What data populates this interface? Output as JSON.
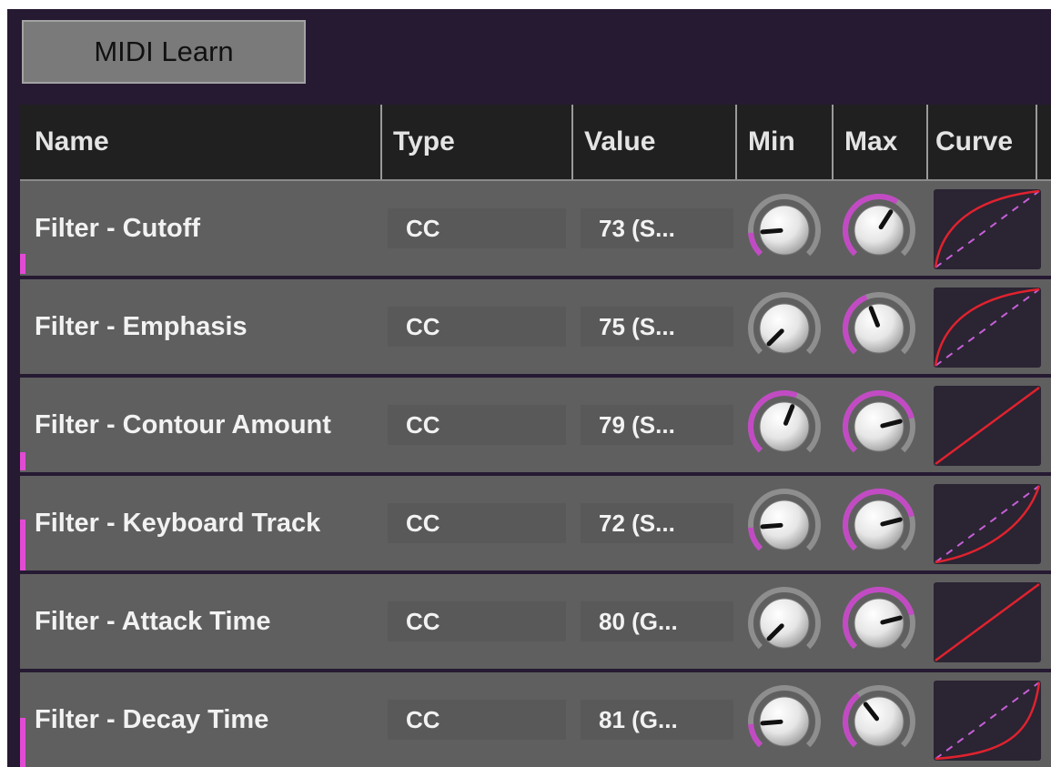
{
  "toolbar": {
    "midi_learn_label": "MIDI Learn"
  },
  "table": {
    "headers": {
      "name": "Name",
      "type": "Type",
      "value": "Value",
      "min": "Min",
      "max": "Max",
      "curve": "Curve"
    },
    "rows": [
      {
        "name": "Filter - Cutoff",
        "type": "CC",
        "value": "73 (S...",
        "min": 0.15,
        "max": 0.62,
        "curve": "log",
        "marker": true
      },
      {
        "name": "Filter - Emphasis",
        "type": "CC",
        "value": "75 (S...",
        "min": 0.0,
        "max": 0.42,
        "curve": "log",
        "marker": false
      },
      {
        "name": "Filter - Contour Amount",
        "type": "CC",
        "value": "79 (S...",
        "min": 0.58,
        "max": 0.78,
        "curve": "linear",
        "marker": true
      },
      {
        "name": "Filter - Keyboard Track",
        "type": "CC",
        "value": "72 (S...",
        "min": 0.15,
        "max": 0.78,
        "curve": "exp",
        "marker": true
      },
      {
        "name": " Filter - Attack Time",
        "type": "CC",
        "value": "80 (G...",
        "min": 0.0,
        "max": 0.78,
        "curve": "linear",
        "marker": false
      },
      {
        "name": "Filter - Decay Time",
        "type": "CC",
        "value": "81 (G...",
        "min": 0.15,
        "max": 0.36,
        "curve": "exp-strong",
        "marker": true
      }
    ]
  },
  "colors": {
    "panel_bg": "#261a33",
    "row_bg": "#5f5f5f",
    "knob_arc_active": "#c24bc4",
    "knob_arc_track": "#8e8e8e",
    "curve_line": "#e0222e",
    "curve_reference": "#c65fd6",
    "marker": "#e14bd3"
  }
}
